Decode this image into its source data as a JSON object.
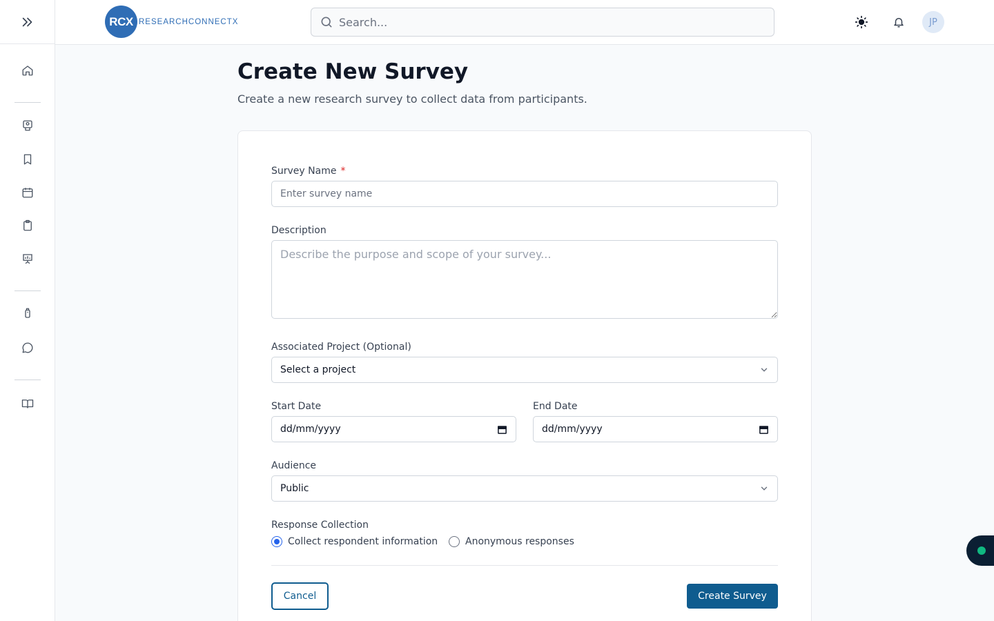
{
  "brand": {
    "logo_mark": "RCX",
    "logo_text": "RESEARCHCONNECTX"
  },
  "header": {
    "search_placeholder": "Search...",
    "avatar_initials": "JP"
  },
  "page": {
    "title": "Create New Survey",
    "subtitle": "Create a new research survey to collect data from participants."
  },
  "form": {
    "survey_name": {
      "label": "Survey Name",
      "required_mark": "*",
      "placeholder": "Enter survey name"
    },
    "description": {
      "label": "Description",
      "placeholder": "Describe the purpose and scope of your survey..."
    },
    "project": {
      "label": "Associated Project (Optional)",
      "value": "Select a project"
    },
    "start_date": {
      "label": "Start Date",
      "placeholder": "dd/mm/yyyy"
    },
    "end_date": {
      "label": "End Date",
      "placeholder": "dd/mm/yyyy"
    },
    "audience": {
      "label": "Audience",
      "value": "Public"
    },
    "response_collection": {
      "label": "Response Collection",
      "options": [
        "Collect respondent information",
        "Anonymous responses"
      ],
      "selected": "Collect respondent information"
    },
    "cancel_label": "Cancel",
    "submit_label": "Create Survey"
  },
  "colors": {
    "brand": "#2f6db5",
    "primary": "#0f5c8f",
    "required": "#dc2626",
    "radio_selected": "#2563eb",
    "status": "#10b981"
  }
}
